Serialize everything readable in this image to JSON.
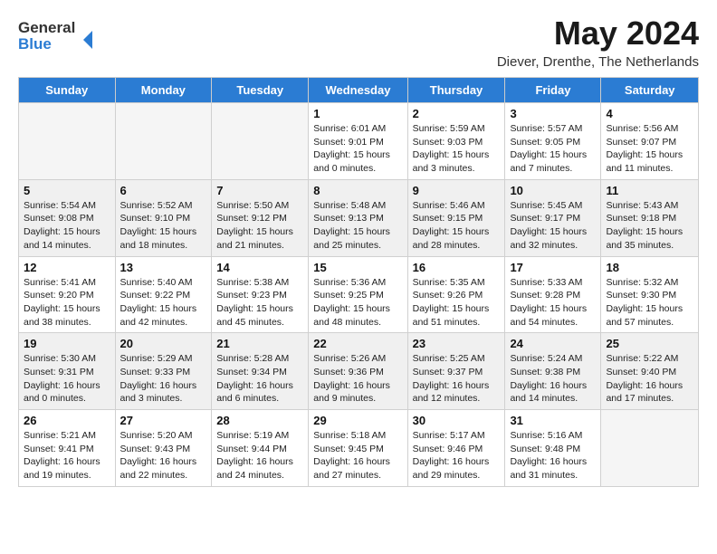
{
  "header": {
    "logo_general": "General",
    "logo_blue": "Blue",
    "month_year": "May 2024",
    "location": "Diever, Drenthe, The Netherlands"
  },
  "days_of_week": [
    "Sunday",
    "Monday",
    "Tuesday",
    "Wednesday",
    "Thursday",
    "Friday",
    "Saturday"
  ],
  "weeks": [
    [
      {
        "day": "",
        "info": ""
      },
      {
        "day": "",
        "info": ""
      },
      {
        "day": "",
        "info": ""
      },
      {
        "day": "1",
        "info": "Sunrise: 6:01 AM\nSunset: 9:01 PM\nDaylight: 15 hours\nand 0 minutes."
      },
      {
        "day": "2",
        "info": "Sunrise: 5:59 AM\nSunset: 9:03 PM\nDaylight: 15 hours\nand 3 minutes."
      },
      {
        "day": "3",
        "info": "Sunrise: 5:57 AM\nSunset: 9:05 PM\nDaylight: 15 hours\nand 7 minutes."
      },
      {
        "day": "4",
        "info": "Sunrise: 5:56 AM\nSunset: 9:07 PM\nDaylight: 15 hours\nand 11 minutes."
      }
    ],
    [
      {
        "day": "5",
        "info": "Sunrise: 5:54 AM\nSunset: 9:08 PM\nDaylight: 15 hours\nand 14 minutes."
      },
      {
        "day": "6",
        "info": "Sunrise: 5:52 AM\nSunset: 9:10 PM\nDaylight: 15 hours\nand 18 minutes."
      },
      {
        "day": "7",
        "info": "Sunrise: 5:50 AM\nSunset: 9:12 PM\nDaylight: 15 hours\nand 21 minutes."
      },
      {
        "day": "8",
        "info": "Sunrise: 5:48 AM\nSunset: 9:13 PM\nDaylight: 15 hours\nand 25 minutes."
      },
      {
        "day": "9",
        "info": "Sunrise: 5:46 AM\nSunset: 9:15 PM\nDaylight: 15 hours\nand 28 minutes."
      },
      {
        "day": "10",
        "info": "Sunrise: 5:45 AM\nSunset: 9:17 PM\nDaylight: 15 hours\nand 32 minutes."
      },
      {
        "day": "11",
        "info": "Sunrise: 5:43 AM\nSunset: 9:18 PM\nDaylight: 15 hours\nand 35 minutes."
      }
    ],
    [
      {
        "day": "12",
        "info": "Sunrise: 5:41 AM\nSunset: 9:20 PM\nDaylight: 15 hours\nand 38 minutes."
      },
      {
        "day": "13",
        "info": "Sunrise: 5:40 AM\nSunset: 9:22 PM\nDaylight: 15 hours\nand 42 minutes."
      },
      {
        "day": "14",
        "info": "Sunrise: 5:38 AM\nSunset: 9:23 PM\nDaylight: 15 hours\nand 45 minutes."
      },
      {
        "day": "15",
        "info": "Sunrise: 5:36 AM\nSunset: 9:25 PM\nDaylight: 15 hours\nand 48 minutes."
      },
      {
        "day": "16",
        "info": "Sunrise: 5:35 AM\nSunset: 9:26 PM\nDaylight: 15 hours\nand 51 minutes."
      },
      {
        "day": "17",
        "info": "Sunrise: 5:33 AM\nSunset: 9:28 PM\nDaylight: 15 hours\nand 54 minutes."
      },
      {
        "day": "18",
        "info": "Sunrise: 5:32 AM\nSunset: 9:30 PM\nDaylight: 15 hours\nand 57 minutes."
      }
    ],
    [
      {
        "day": "19",
        "info": "Sunrise: 5:30 AM\nSunset: 9:31 PM\nDaylight: 16 hours\nand 0 minutes."
      },
      {
        "day": "20",
        "info": "Sunrise: 5:29 AM\nSunset: 9:33 PM\nDaylight: 16 hours\nand 3 minutes."
      },
      {
        "day": "21",
        "info": "Sunrise: 5:28 AM\nSunset: 9:34 PM\nDaylight: 16 hours\nand 6 minutes."
      },
      {
        "day": "22",
        "info": "Sunrise: 5:26 AM\nSunset: 9:36 PM\nDaylight: 16 hours\nand 9 minutes."
      },
      {
        "day": "23",
        "info": "Sunrise: 5:25 AM\nSunset: 9:37 PM\nDaylight: 16 hours\nand 12 minutes."
      },
      {
        "day": "24",
        "info": "Sunrise: 5:24 AM\nSunset: 9:38 PM\nDaylight: 16 hours\nand 14 minutes."
      },
      {
        "day": "25",
        "info": "Sunrise: 5:22 AM\nSunset: 9:40 PM\nDaylight: 16 hours\nand 17 minutes."
      }
    ],
    [
      {
        "day": "26",
        "info": "Sunrise: 5:21 AM\nSunset: 9:41 PM\nDaylight: 16 hours\nand 19 minutes."
      },
      {
        "day": "27",
        "info": "Sunrise: 5:20 AM\nSunset: 9:43 PM\nDaylight: 16 hours\nand 22 minutes."
      },
      {
        "day": "28",
        "info": "Sunrise: 5:19 AM\nSunset: 9:44 PM\nDaylight: 16 hours\nand 24 minutes."
      },
      {
        "day": "29",
        "info": "Sunrise: 5:18 AM\nSunset: 9:45 PM\nDaylight: 16 hours\nand 27 minutes."
      },
      {
        "day": "30",
        "info": "Sunrise: 5:17 AM\nSunset: 9:46 PM\nDaylight: 16 hours\nand 29 minutes."
      },
      {
        "day": "31",
        "info": "Sunrise: 5:16 AM\nSunset: 9:48 PM\nDaylight: 16 hours\nand 31 minutes."
      },
      {
        "day": "",
        "info": ""
      }
    ]
  ]
}
